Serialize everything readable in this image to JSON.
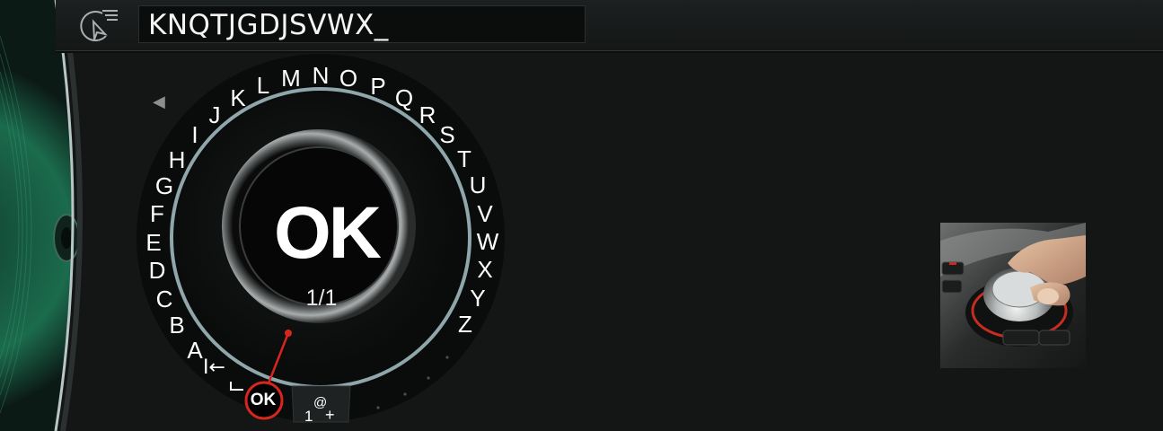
{
  "input": {
    "text": "KNQTJGDJSVWX_"
  },
  "speller": {
    "ok_label": "OK",
    "page_indicator": "1/1",
    "ok_small_label": "OK",
    "special_chars": {
      "digit": "1",
      "at": "@",
      "plus": "+"
    },
    "delete_symbol": "I←",
    "letters": [
      "A",
      "B",
      "C",
      "D",
      "E",
      "F",
      "G",
      "H",
      "I",
      "J",
      "K",
      "L",
      "M",
      "N",
      "O",
      "P",
      "Q",
      "R",
      "S",
      "T",
      "U",
      "V",
      "W",
      "X",
      "Y",
      "Z"
    ]
  },
  "icons": {
    "nav": "navigation-destination-icon",
    "back": "back-arrow-icon",
    "delete": "delete-icon",
    "space": "space-icon"
  },
  "colors": {
    "accent_red": "#d8261d",
    "ring": "#8fa6ab",
    "green_deco": "#1d6a4e"
  }
}
